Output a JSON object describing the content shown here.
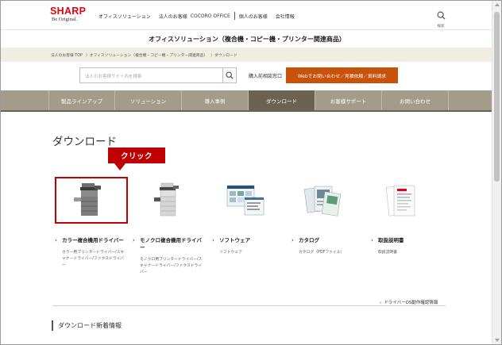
{
  "header": {
    "brand": "SHARP",
    "tagline": "Be Original.",
    "topnav": [
      "オフィスソリューション",
      "法人のお客様",
      "COCORO OFFICE",
      "個人のお客様",
      "会社情報"
    ],
    "search_label": "検索"
  },
  "subtitle": "オフィスソリューション（複合機・コピー機・プリンター関連商品）",
  "breadcrumb": [
    "法人のお客様 TOP",
    "〉オフィスソリューション（複合機・コピー機・プリンター関連商品）",
    "〉ダウンロード"
  ],
  "search": {
    "placeholder": "法人のお客様サイト内を検索",
    "contact_label": "購入前相談窓口",
    "web_button": "Webでお問い合わせ／見積依頼／資料請求"
  },
  "mainnav": [
    {
      "label": "製品ラインアップ",
      "active": false
    },
    {
      "label": "ソリューション",
      "active": false
    },
    {
      "label": "導入事例",
      "active": false
    },
    {
      "label": "ダウンロード",
      "active": true
    },
    {
      "label": "お客様サポート",
      "active": false
    },
    {
      "label": "お問い合わせ",
      "active": false
    }
  ],
  "page_title": "ダウンロード",
  "callout": "クリック",
  "categories": [
    {
      "title": "カラー複合機用ドライバー",
      "desc": "カラー用プリンタードライバー/スキャナードライバー/ファクスドライバー"
    },
    {
      "title": "モノクロ複合機用ドライバー",
      "desc": "モノクロ用プリンタードライバー/スキャナードライバー/ファクスドライバー"
    },
    {
      "title": "ソフトウェア",
      "desc": "ソフトウェア"
    },
    {
      "title": "カタログ",
      "desc": "カタログ（PDFファイル）"
    },
    {
      "title": "取扱説明書",
      "desc": "取扱説明書"
    }
  ],
  "driver_os_link": "ドライバーOS動作確認情報",
  "news_title": "ダウンロード新着情報",
  "colors": {
    "brand": "#e60012",
    "accent": "#c8520a",
    "nav": "#a49c8a",
    "nav_active": "#6b6251",
    "callout": "#c00000"
  }
}
